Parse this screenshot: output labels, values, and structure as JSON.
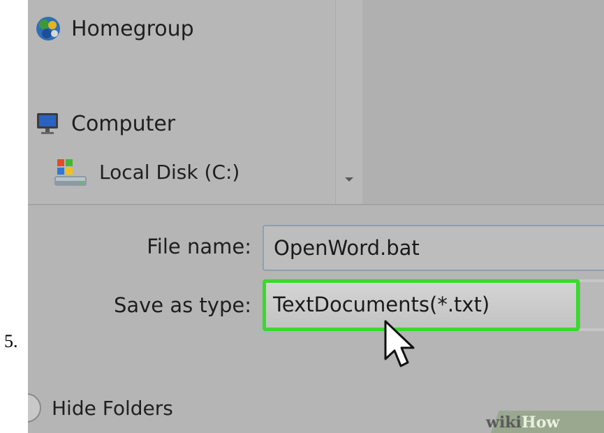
{
  "step": {
    "number": "5."
  },
  "navigation": {
    "items": [
      {
        "label": "Homegroup",
        "icon": "homegroup-icon"
      },
      {
        "label": "Computer",
        "icon": "computer-icon"
      },
      {
        "label": "Local Disk (C:)",
        "icon": "local-disk-icon"
      }
    ]
  },
  "form": {
    "file_name_label": "File name:",
    "file_name_value": "OpenWord.bat",
    "save_as_type_label": "Save as type:",
    "save_as_type_value": "TextDocuments(*.txt)"
  },
  "footer": {
    "hide_folders_label": "Hide Folders",
    "hide_folders_icon": "collapse-toggle-icon"
  },
  "watermark": {
    "part1": "wiki",
    "part2": "How"
  },
  "colors": {
    "highlight": "#39d92e",
    "dialog_background": "#b5b5b5"
  }
}
